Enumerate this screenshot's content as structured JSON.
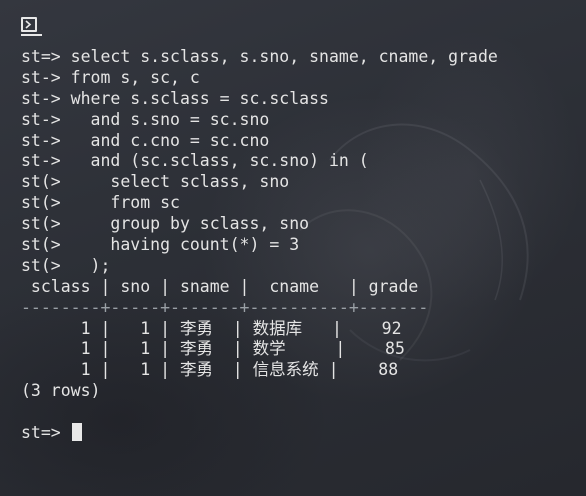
{
  "terminal": {
    "lines": [
      "st=> select s.sclass, s.sno, sname, cname, grade",
      "st-> from s, sc, c",
      "st-> where s.sclass = sc.sclass",
      "st->   and s.sno = sc.sno",
      "st->   and c.cno = sc.cno",
      "st->   and (sc.sclass, sc.sno) in (",
      "st(>     select sclass, sno",
      "st(>     from sc",
      "st(>     group by sclass, sno",
      "st(>     having count(*) = 3",
      "st(>   );",
      " sclass | sno | sname |  cname   | grade ",
      "--------+-----+-------+----------+-------",
      "      1 |   1 | 李勇  | 数据库   |    92",
      "      1 |   1 | 李勇  | 数学     |    85",
      "      1 |   1 | 李勇  | 信息系统 |    88",
      "(3 rows)",
      "",
      "st=> "
    ]
  },
  "icons": {
    "terminal": "terminal-icon"
  },
  "colors": {
    "background": "#2b2e35",
    "text": "#e4e4e4",
    "separator": "#9aa0a6",
    "cursor": "#e8e8e8"
  }
}
